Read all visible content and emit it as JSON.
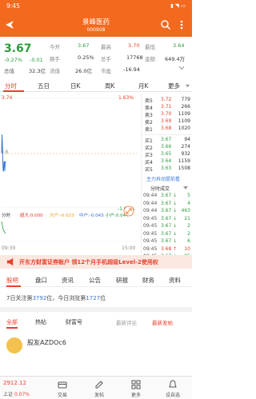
{
  "status": {
    "time": "9:45",
    "icons": "▮ ◥ ▭"
  },
  "header": {
    "title": "景峰医药",
    "code": "000908"
  },
  "quote": {
    "price": "3.67",
    "pct": "-0.27%",
    "chg": "-0.01",
    "turnover_lbl": "总值",
    "turnover_val": "32.3亿",
    "rows": [
      [
        {
          "l": "今开",
          "v": "3.67",
          "c": "green"
        },
        {
          "l": "最高",
          "v": "3.70",
          "c": "red"
        },
        {
          "l": "最低",
          "v": "3.64",
          "c": "green"
        }
      ],
      [
        {
          "l": "换手",
          "v": "0.25%",
          "c": ""
        },
        {
          "l": "总手",
          "v": "17768",
          "c": ""
        },
        {
          "l": "金额",
          "v": "649.4万",
          "c": ""
        }
      ],
      [
        {
          "l": "流值",
          "v": "26.0亿",
          "c": ""
        },
        {
          "l": "市盈",
          "v": "-16.94",
          "c": ""
        },
        {
          "l": "",
          "v": "",
          "c": ""
        }
      ]
    ]
  },
  "tabs": [
    "分时",
    "五日",
    "日K",
    "周K",
    "月K",
    "更多"
  ],
  "chart": {
    "price_top": "3.74",
    "pct_top": "1.63%",
    "pct_bottom": "-1.63%",
    "time_left": "09:30",
    "time_right": "15:00",
    "line_label_left": "分时",
    "flow_labels": [
      {
        "t": "超大:0.000",
        "c": "#e8402c"
      },
      {
        "t": "大户:-0.023",
        "c": "#f3a11f"
      },
      {
        "t": "中户:-0.043",
        "c": "#3a78d6"
      },
      {
        "t": "小户:0.044",
        "c": "#2a9d3e"
      }
    ],
    "mid_label": "3.6",
    "prices": [
      3.68,
      3.7,
      3.69,
      3.67,
      3.66,
      3.66,
      3.67,
      3.67,
      3.66,
      3.67,
      3.67,
      3.67
    ]
  },
  "orderbook": {
    "sells": [
      {
        "l": "卖5",
        "p": "3.72",
        "v": "779"
      },
      {
        "l": "卖4",
        "p": "3.71",
        "v": "266"
      },
      {
        "l": "卖3",
        "p": "3.70",
        "v": "1109"
      },
      {
        "l": "卖2",
        "p": "3.69",
        "v": "1109"
      },
      {
        "l": "卖1",
        "p": "3.68",
        "v": "1020"
      }
    ],
    "buys": [
      {
        "l": "买1",
        "p": "3.67",
        "v": "94"
      },
      {
        "l": "买2",
        "p": "3.66",
        "v": "274"
      },
      {
        "l": "买3",
        "p": "3.65",
        "v": "932"
      },
      {
        "l": "买4",
        "p": "3.64",
        "v": "1159"
      },
      {
        "l": "买5",
        "p": "3.63",
        "v": "1508"
      }
    ],
    "zhuli": "主力异动提前看",
    "fenshi_label": "分时成交",
    "trades": [
      {
        "t": "09:44",
        "p": "3.67",
        "a": "↓",
        "v": "5"
      },
      {
        "t": "09:44",
        "p": "3.67",
        "a": "↓",
        "v": "4"
      },
      {
        "t": "09:44",
        "p": "3.67",
        "a": "↓",
        "v": "463"
      },
      {
        "t": "09:45",
        "p": "3.67",
        "a": "↓",
        "v": "21"
      },
      {
        "t": "09:45",
        "p": "3.67",
        "a": "↓",
        "v": "2"
      },
      {
        "t": "09:45",
        "p": "3.67",
        "a": "↓",
        "v": "2"
      },
      {
        "t": "09:45",
        "p": "3.67",
        "a": "↓",
        "v": "6"
      },
      {
        "t": "09:45",
        "p": "3.68",
        "a": "↑",
        "v": "10"
      },
      {
        "t": "09:45",
        "p": "3.67",
        "a": "↓",
        "v": "95"
      }
    ]
  },
  "banner": {
    "text": "开东方财富证券账户 领12个月手机超级Level-2使用权"
  },
  "sec_tabs": [
    "股吧",
    "盘口",
    "资讯",
    "公告",
    "研报",
    "财务",
    "资料"
  ],
  "follow": {
    "prefix": "7日关注第",
    "rank": "3792",
    "mid": "位，今日浏览第",
    "rank2": "1727",
    "suffix": "位"
  },
  "sub_tabs": [
    "全部",
    "热帖",
    "财富号"
  ],
  "reply_sort": "最新评论",
  "latest_reply": "最新发帖",
  "post": {
    "username": "股友AZDOc6"
  },
  "bottom": {
    "index_price": "2912.12",
    "index_label": "上证",
    "index_chg": "0.07%",
    "items": [
      {
        "icon": "trade-icon",
        "label": "交易"
      },
      {
        "icon": "post-icon",
        "label": "发帖"
      },
      {
        "icon": "more-icon",
        "label": "更多"
      },
      {
        "icon": "alert-icon",
        "label": "设自选"
      }
    ]
  },
  "colors": {
    "brand": "#f36a1f",
    "up": "#e8402c",
    "down": "#2a9d3e"
  }
}
